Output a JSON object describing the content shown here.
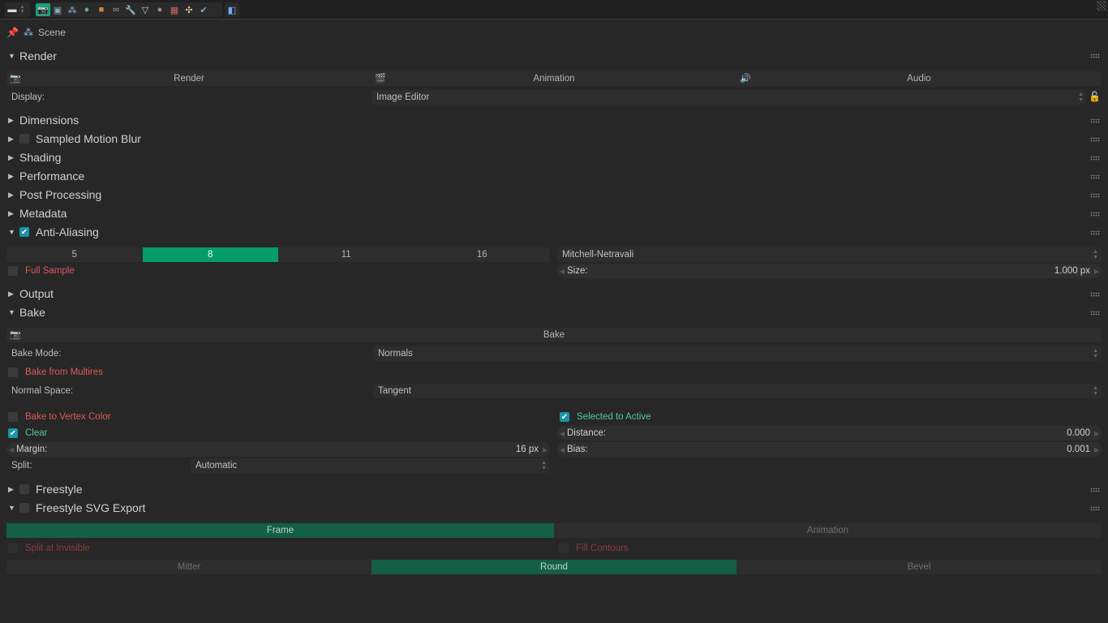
{
  "toolbar": {
    "editor_type_icon": "properties-editor-icon",
    "tabs": [
      {
        "icon": "render-camera-icon",
        "active": true
      },
      {
        "icon": "render-layers-icon",
        "active": false
      },
      {
        "icon": "scene-icon",
        "active": false
      },
      {
        "icon": "world-icon",
        "active": false
      },
      {
        "icon": "object-icon",
        "active": false
      },
      {
        "icon": "constraints-icon",
        "active": false
      },
      {
        "icon": "modifiers-wrench-icon",
        "active": false
      },
      {
        "icon": "object-data-mesh-icon",
        "active": false
      },
      {
        "icon": "material-icon",
        "active": false
      },
      {
        "icon": "texture-icon",
        "active": false
      },
      {
        "icon": "particles-icon",
        "active": false
      },
      {
        "icon": "physics-icon",
        "active": false
      }
    ],
    "extra_icon": "overlap-icon"
  },
  "context": {
    "label": "Scene"
  },
  "render_panel": {
    "title": "Render",
    "buttons": [
      {
        "label": "Render",
        "icon": "render-still-icon"
      },
      {
        "label": "Animation",
        "icon": "clapperboard-icon"
      },
      {
        "label": "Audio",
        "icon": "speaker-icon"
      }
    ],
    "display_label": "Display:",
    "display_value": "Image Editor"
  },
  "panels": [
    {
      "title": "Dimensions",
      "expanded": false,
      "checkbox": null
    },
    {
      "title": "Sampled Motion Blur",
      "expanded": false,
      "checkbox": false
    },
    {
      "title": "Shading",
      "expanded": false,
      "checkbox": null
    },
    {
      "title": "Performance",
      "expanded": false,
      "checkbox": null
    },
    {
      "title": "Post Processing",
      "expanded": false,
      "checkbox": null
    },
    {
      "title": "Metadata",
      "expanded": false,
      "checkbox": null
    }
  ],
  "anti_aliasing": {
    "title": "Anti-Aliasing",
    "enabled": true,
    "samples": [
      "5",
      "8",
      "11",
      "16"
    ],
    "selected_sample": "8",
    "filter": "Mitchell-Netravali",
    "full_sample_label": "Full Sample",
    "full_sample": false,
    "size_label": "Size:",
    "size_value": "1.000 px"
  },
  "output_panel": {
    "title": "Output"
  },
  "bake": {
    "title": "Bake",
    "button_label": "Bake",
    "mode_label": "Bake Mode:",
    "mode_value": "Normals",
    "from_multires_label": "Bake from Multires",
    "from_multires": false,
    "normal_space_label": "Normal Space:",
    "normal_space_value": "Tangent",
    "vertex_color_label": "Bake to Vertex Color",
    "vertex_color": false,
    "selected_to_active_label": "Selected to Active",
    "selected_to_active": true,
    "clear_label": "Clear",
    "clear": true,
    "distance_label": "Distance:",
    "distance_value": "0.000",
    "margin_label": "Margin:",
    "margin_value": "16 px",
    "bias_label": "Bias:",
    "bias_value": "0.001",
    "split_label": "Split:",
    "split_value": "Automatic"
  },
  "freestyle": {
    "title": "Freestyle",
    "enabled": false
  },
  "svg_export": {
    "title": "Freestyle SVG Export",
    "enabled": false,
    "modes": [
      "Frame",
      "Animation"
    ],
    "selected_mode": "Frame",
    "split_invisible_label": "Split at Invisible",
    "fill_contours_label": "Fill Contours",
    "joins": [
      "Mitter",
      "Round",
      "Bevel"
    ],
    "selected_join": "Round"
  },
  "colors": {
    "accent": "#069b6a",
    "accent_inactive": "#145f46",
    "checkbox_on": "#1a93a6",
    "warning_text": "#d9585d"
  }
}
